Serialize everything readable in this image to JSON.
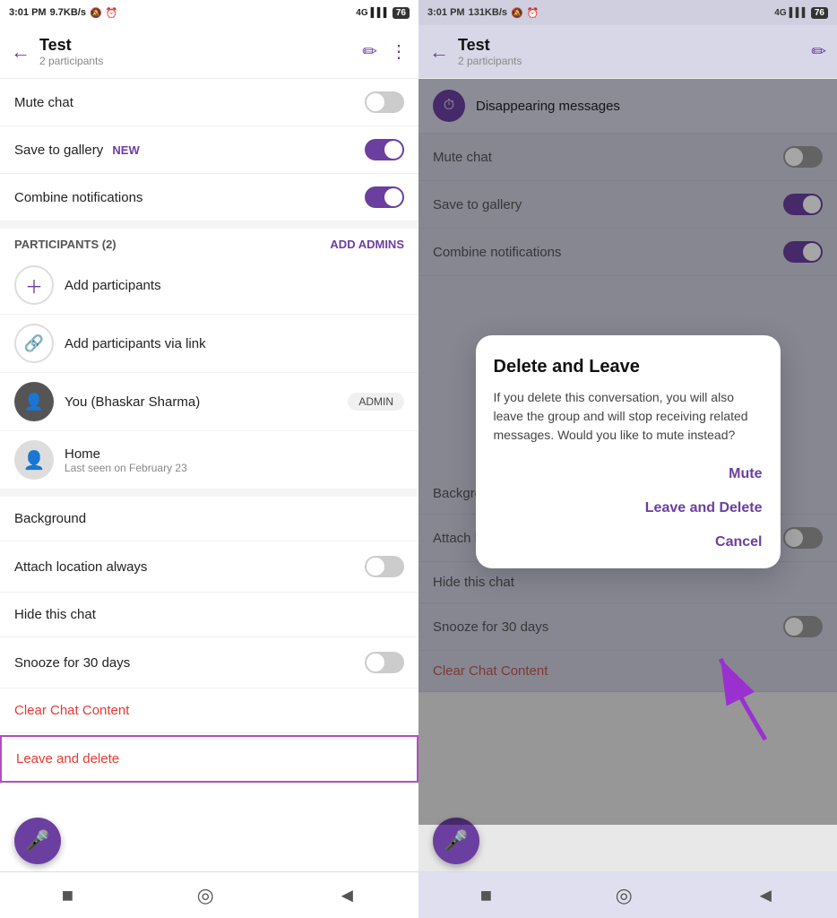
{
  "left_panel": {
    "status_bar": {
      "time": "3:01 PM",
      "data_speed": "9.7KB/s",
      "battery": "76"
    },
    "header": {
      "title": "Test",
      "subtitle": "2 participants",
      "back_label": "←",
      "edit_icon": "✏",
      "more_icon": "⋮"
    },
    "settings": [
      {
        "label": "Mute chat",
        "toggle": "off"
      },
      {
        "label": "Save to gallery",
        "badge": "NEW",
        "toggle": "on"
      },
      {
        "label": "Combine notifications",
        "toggle": "on"
      }
    ],
    "participants_section": {
      "title": "PARTICIPANTS (2)",
      "add_admins": "ADD ADMINS",
      "items": [
        {
          "type": "add",
          "name": "Add participants"
        },
        {
          "type": "link",
          "name": "Add participants via link"
        },
        {
          "type": "user",
          "name": "You (Bhaskar Sharma)",
          "badge": "ADMIN"
        },
        {
          "type": "user",
          "name": "Home",
          "sub": "Last seen on February 23"
        }
      ]
    },
    "actions": [
      {
        "label": "Background",
        "toggle": false
      },
      {
        "label": "Attach location always",
        "toggle": "off"
      },
      {
        "label": "Hide this chat",
        "toggle": false
      },
      {
        "label": "Snooze for 30 days",
        "toggle": "off"
      },
      {
        "label": "Clear Chat Content",
        "color": "red",
        "toggle": false
      },
      {
        "label": "Leave and delete",
        "color": "red",
        "highlighted": true
      }
    ],
    "bottom_nav": [
      "■",
      "◎",
      "◄"
    ],
    "mic_label": "🎤"
  },
  "right_panel": {
    "status_bar": {
      "time": "3:01 PM",
      "data_speed": "131KB/s",
      "battery": "76"
    },
    "header": {
      "title": "Test",
      "subtitle": "2 participants",
      "back_label": "←",
      "edit_icon": "✏"
    },
    "disappearing": {
      "icon": "⏱",
      "label": "Disappearing messages"
    },
    "bg_rows": [
      {
        "label": "Mute chat",
        "toggle": "off"
      },
      {
        "label": "Save to gallery",
        "toggle": "on"
      },
      {
        "label": "Combine notifications",
        "toggle": "on"
      }
    ],
    "bg_bottom_rows": [
      {
        "label": "Background",
        "toggle": false
      },
      {
        "label": "Attach location alway...",
        "toggle": "off"
      },
      {
        "label": "Hide this chat",
        "toggle": false
      },
      {
        "label": "Snooze for 30 days",
        "toggle": "off"
      },
      {
        "label": "Clear Chat Content",
        "color": "red"
      }
    ],
    "modal": {
      "title": "Delete and Leave",
      "body": "If you delete this conversation, you will also leave the group and will stop receiving related messages. Would you like to mute instead?",
      "btn_mute": "Mute",
      "btn_leave": "Leave and Delete",
      "btn_cancel": "Cancel"
    },
    "bottom_nav": [
      "■",
      "◎",
      "◄"
    ],
    "mic_label": "🎤"
  }
}
